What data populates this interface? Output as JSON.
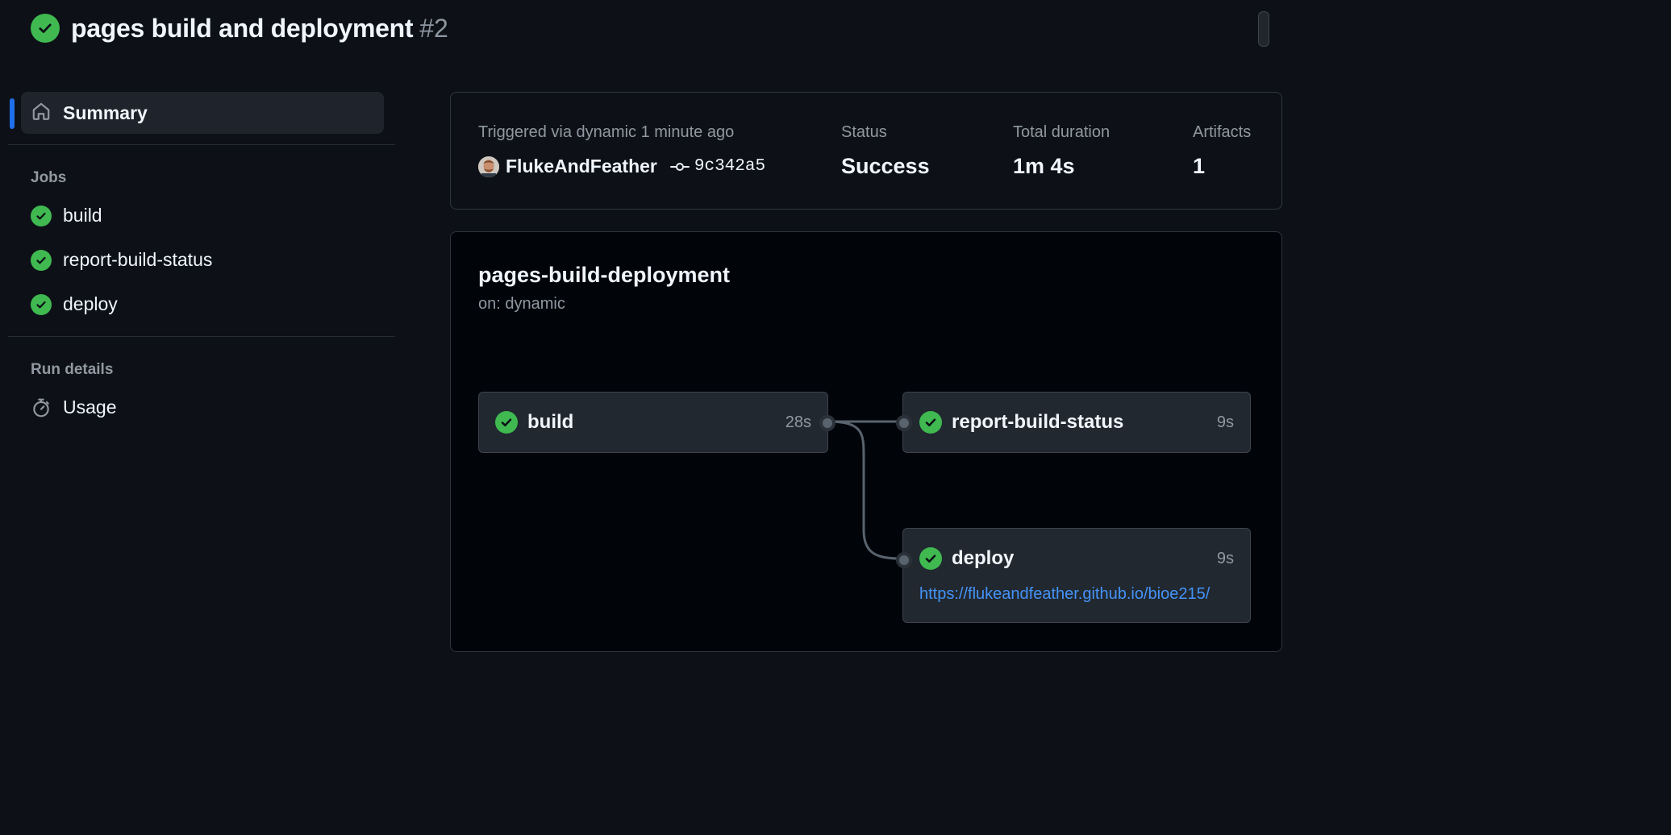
{
  "header": {
    "title": "pages build and deployment",
    "run_number": "#2",
    "status_icon": "check-circle-fill-icon",
    "status_color": "#3fb950"
  },
  "sidebar": {
    "summary_label": "Summary",
    "jobs_section": "Jobs",
    "jobs": [
      {
        "label": "build",
        "icon": "check-circle-fill-icon"
      },
      {
        "label": "report-build-status",
        "icon": "check-circle-fill-icon"
      },
      {
        "label": "deploy",
        "icon": "check-circle-fill-icon"
      }
    ],
    "run_details_section": "Run details",
    "usage_label": "Usage",
    "active_color": "#1f6feb"
  },
  "run_summary": {
    "trigger_text": "Triggered via dynamic 1 minute ago",
    "actor": "FlukeAndFeather",
    "commit_sha": "9c342a5",
    "status_label": "Status",
    "status_value": "Success",
    "duration_label": "Total duration",
    "duration_value": "1m 4s",
    "artifacts_label": "Artifacts",
    "artifacts_value": "1"
  },
  "workflow": {
    "name": "pages-build-deployment",
    "trigger": "on: dynamic",
    "jobs": {
      "build": {
        "name": "build",
        "duration": "28s"
      },
      "report": {
        "name": "report-build-status",
        "duration": "9s"
      },
      "deploy": {
        "name": "deploy",
        "duration": "9s",
        "url": "https://flukeandfeather.github.io/bioe215/"
      }
    },
    "link_color": "#4493f8"
  }
}
